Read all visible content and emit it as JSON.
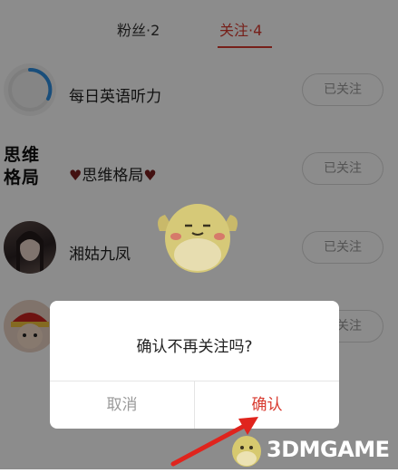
{
  "tabs": [
    {
      "label": "粉丝·2",
      "active": false
    },
    {
      "label": "关注·4",
      "active": true
    }
  ],
  "list": [
    {
      "name": "每日英语听力",
      "button": "已关注"
    },
    {
      "name_prefix": "♥",
      "name": "思维格局",
      "name_suffix": "♥",
      "avatar_text": "思维格局",
      "button": "已关注"
    },
    {
      "name": "湘姑九凤",
      "button": "已关注"
    },
    {
      "name": "",
      "button": "已关注"
    }
  ],
  "dialog": {
    "message": "确认不再关注吗?",
    "cancel": "取消",
    "confirm": "确认"
  },
  "watermark": {
    "text": "3DMGAME"
  },
  "colors": {
    "accent": "#d83a2f",
    "overlay": "rgba(0,0,0,0.45)"
  }
}
